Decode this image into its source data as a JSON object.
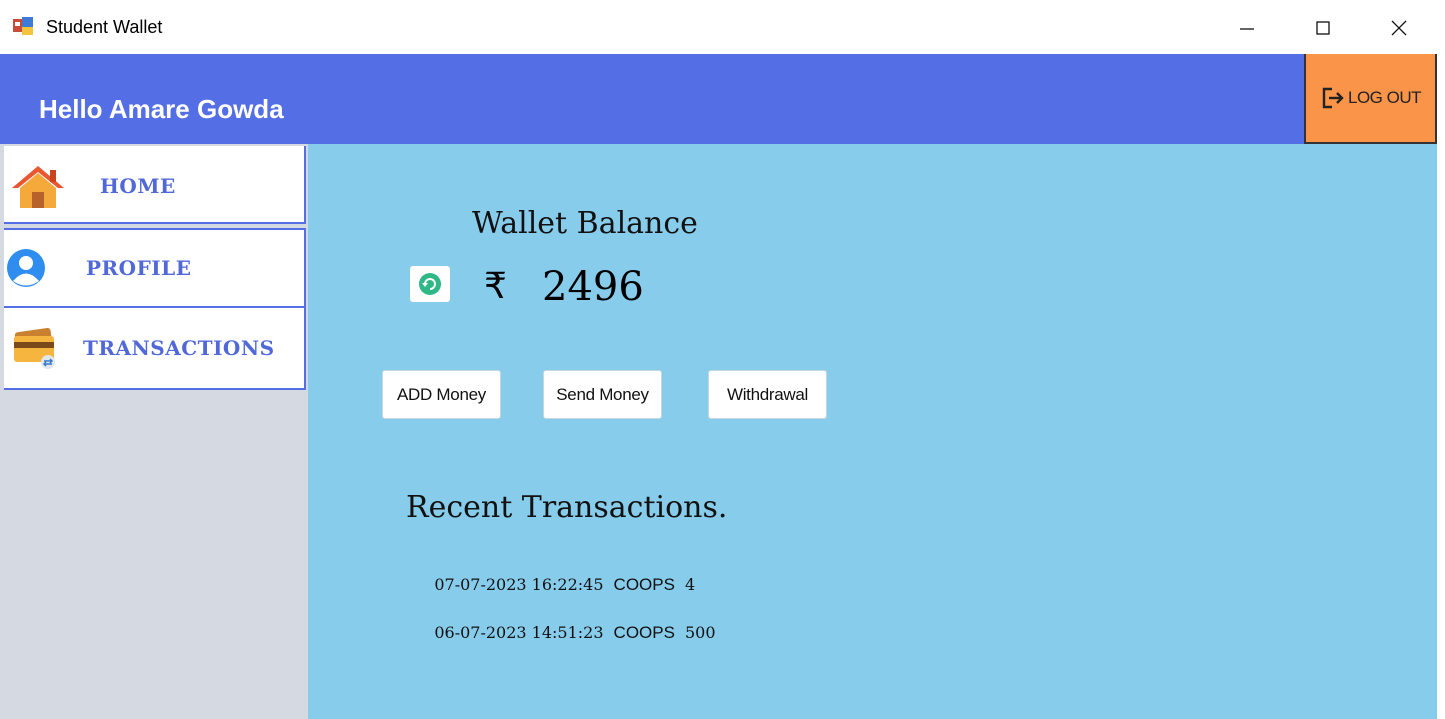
{
  "window": {
    "title": "Student Wallet",
    "controls": [
      "minimize",
      "maximize",
      "close"
    ]
  },
  "header": {
    "greeting": "Hello Amare Gowda",
    "logout_label": "LOG OUT",
    "bg_color": "#546ee6",
    "logout_color": "#f99448"
  },
  "sidebar": {
    "items": [
      {
        "label": "HOME",
        "icon": "house-icon"
      },
      {
        "label": "PROFILE",
        "icon": "user-icon"
      },
      {
        "label": "TRANSACTIONS",
        "icon": "card-icon"
      }
    ],
    "label_color": "#5068d8"
  },
  "main": {
    "bg_color": "#87cceb",
    "wallet_title": "Wallet Balance",
    "currency_symbol": "₹",
    "balance": "2496",
    "buttons": {
      "add": "ADD Money",
      "send": "Send Money",
      "withdraw": "Withdrawal"
    },
    "recent_title": "Recent Transactions.",
    "transactions": [
      {
        "datetime": "07-07-2023 16:22:45",
        "name": "COOPS",
        "amount": "4"
      },
      {
        "datetime": "06-07-2023 14:51:23",
        "name": "COOPS",
        "amount": "500"
      }
    ]
  }
}
